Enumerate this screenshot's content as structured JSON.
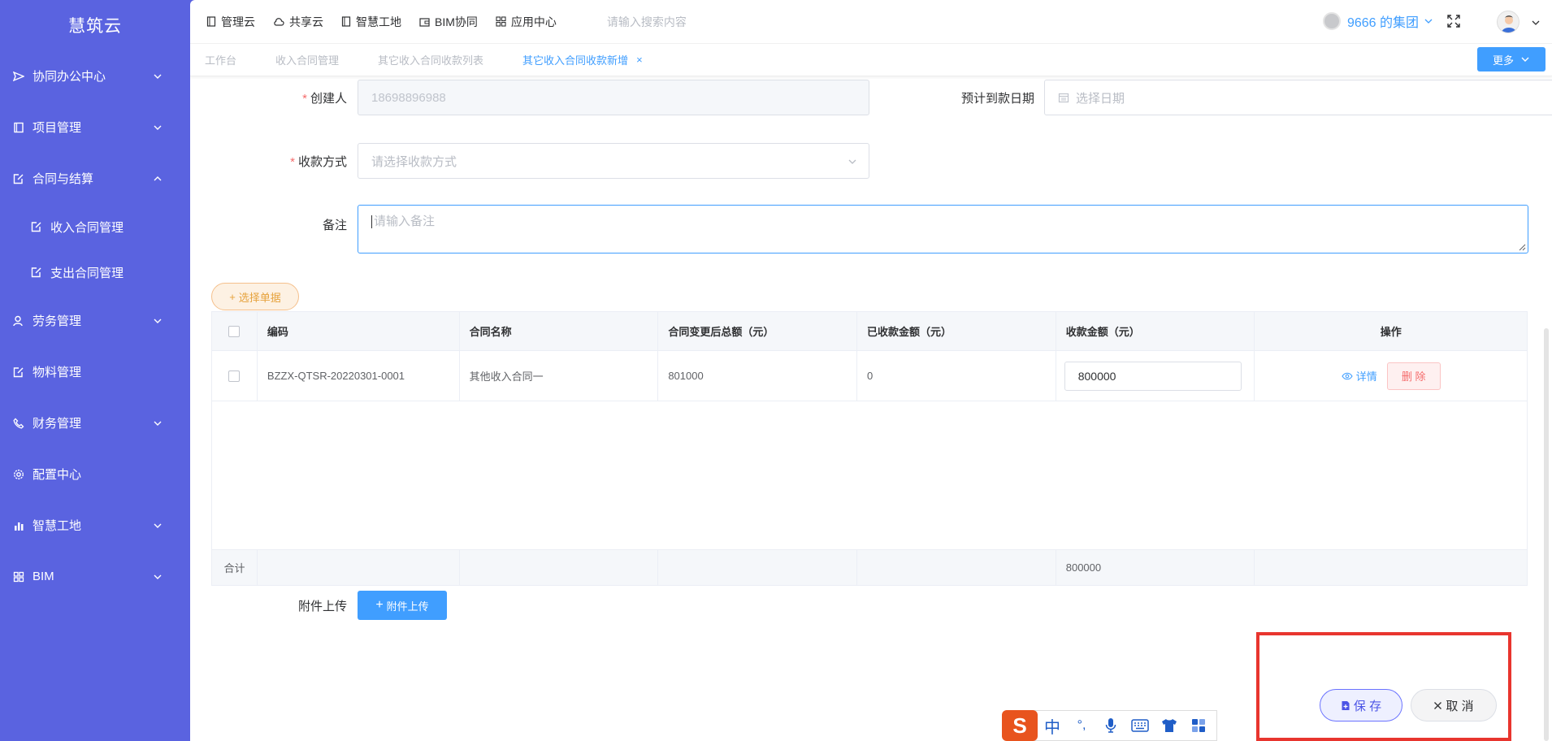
{
  "app": {
    "brand": "慧筑云"
  },
  "sidebar": {
    "items": [
      {
        "label": "协同办公中心"
      },
      {
        "label": "项目管理"
      },
      {
        "label": "合同与结算"
      },
      {
        "label": "收入合同管理"
      },
      {
        "label": "支出合同管理"
      },
      {
        "label": "劳务管理"
      },
      {
        "label": "物料管理"
      },
      {
        "label": "财务管理"
      },
      {
        "label": "配置中心"
      },
      {
        "label": "智慧工地"
      },
      {
        "label": "BIM"
      }
    ]
  },
  "topbar": {
    "nav": [
      {
        "label": "管理云"
      },
      {
        "label": "共享云"
      },
      {
        "label": "智慧工地"
      },
      {
        "label": "BIM协同"
      },
      {
        "label": "应用中心"
      }
    ],
    "search_placeholder": "请输入搜索内容",
    "org": "9666 的集团"
  },
  "tabs": [
    {
      "label": "工作台"
    },
    {
      "label": "收入合同管理"
    },
    {
      "label": "其它收入合同收款列表"
    },
    {
      "label": "其它收入合同收款新增",
      "close": "×"
    }
  ],
  "more_label": "更多",
  "form": {
    "creator_label": "创建人",
    "creator_value": "18698896988",
    "expected_date_label": "预计到款日期",
    "expected_date_placeholder": "选择日期",
    "method_label": "收款方式",
    "method_placeholder": "请选择收款方式",
    "remark_label": "备注",
    "remark_placeholder": "请输入备注",
    "required_mark": "*"
  },
  "select_doc_label": "选择单据",
  "table": {
    "headers": [
      "编码",
      "合同名称",
      "合同变更后总额（元）",
      "已收款金额（元）",
      "收款金额（元）",
      "操作"
    ],
    "rows": [
      {
        "code": "BZZX-QTSR-20220301-0001",
        "name": "其他收入合同一",
        "total": "801000",
        "received": "0",
        "amount": "800000",
        "detail": "详情",
        "delete": "删 除"
      }
    ],
    "footer": {
      "label": "合计",
      "amount_total": "800000"
    }
  },
  "attachment": {
    "label": "附件上传",
    "button": "附件上传"
  },
  "actions": {
    "save": "保 存",
    "cancel": "取 消"
  },
  "ime": {
    "chinese": "中",
    "punct": "°,"
  },
  "colors": {
    "sidebar": "#5a63e0",
    "primary": "#409eff",
    "danger": "#f56c6c",
    "highlight_box": "#e8352e"
  }
}
